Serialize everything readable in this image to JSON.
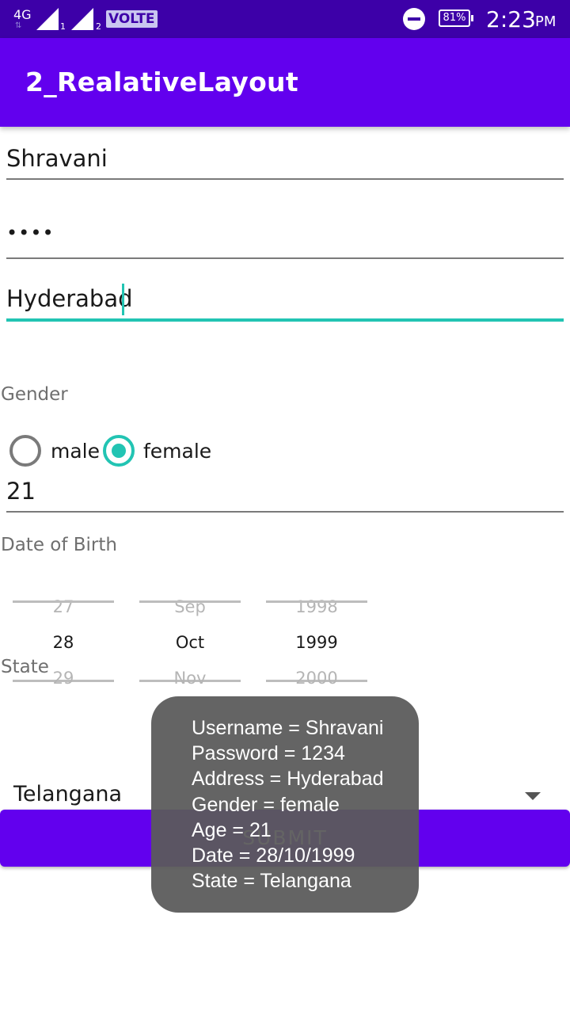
{
  "status_bar": {
    "network_type": "4G",
    "sim1_label": "1",
    "sim2_label": "2",
    "volte_label": "VOLTE",
    "battery_percent": "81%",
    "time": "2:23",
    "ampm": "PM"
  },
  "app_bar": {
    "title": "2_RealativeLayout"
  },
  "form": {
    "username_value": "Shravani",
    "password_value": "••••",
    "address_value": "Hyderabad",
    "gender_label": "Gender",
    "gender_options": [
      {
        "label": "male",
        "checked": false
      },
      {
        "label": "female",
        "checked": true
      }
    ],
    "age_value": "21",
    "dob_label": "Date of Birth",
    "date_picker": {
      "day": {
        "prev": "27",
        "selected": "28",
        "next": "29"
      },
      "month": {
        "prev": "Sep",
        "selected": "Oct",
        "next": "Nov"
      },
      "year": {
        "prev": "1998",
        "selected": "1999",
        "next": "2000"
      }
    },
    "state_label": "State",
    "state_selected": "Telangana",
    "submit_label": "SUBMIT"
  },
  "toast": {
    "lines": [
      "Username = Shravani",
      "Password = 1234",
      "Address = Hyderabad",
      "Gender = female",
      "Age = 21",
      "Date = 28/10/1999",
      "State = Telangana"
    ]
  },
  "colors": {
    "status_bar": "#3d00a8",
    "primary": "#6200ee",
    "accent": "#22c4b3"
  }
}
